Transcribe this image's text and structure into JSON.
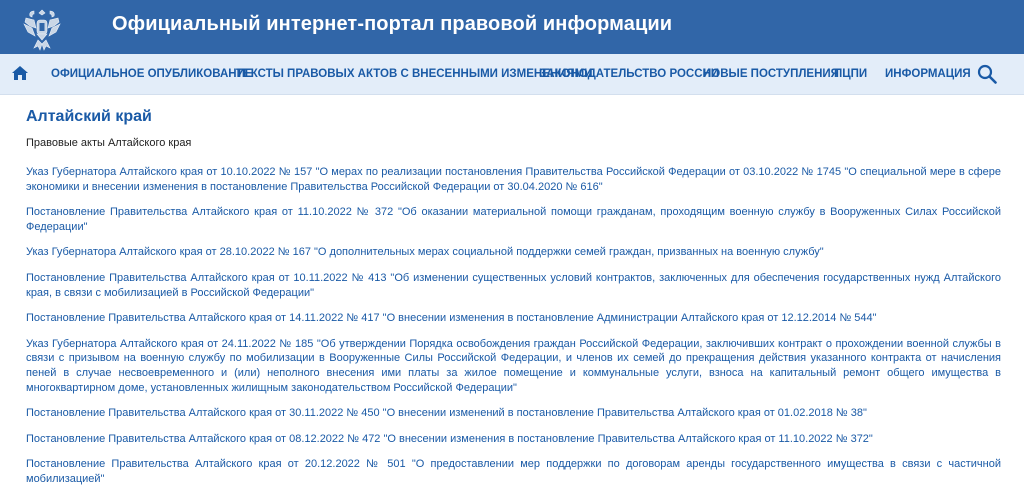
{
  "header": {
    "site_title": "Официальный интернет-портал правовой информации",
    "brand_color": "#3166a8"
  },
  "nav": {
    "home_icon": "home-icon",
    "search_icon": "search-icon",
    "items": [
      {
        "label": "ОФИЦИАЛЬНОЕ ОПУБЛИКОВАНИЕ"
      },
      {
        "label": "ТЕКСТЫ ПРАВОВЫХ АКТОВ С ВНЕСЕННЫМИ ИЗМЕНЕНИЯМИ"
      },
      {
        "label": "ЗАКОНОДАТЕЛЬСТВО РОССИИ"
      },
      {
        "label": "НОВЫЕ ПОСТУПЛЕНИЯ"
      },
      {
        "label": "ПЦПИ"
      },
      {
        "label": "ИНФОРМАЦИЯ"
      }
    ]
  },
  "main": {
    "region_title": "Алтайский край",
    "subtitle": "Правовые акты Алтайского края",
    "link_color": "#1a5aa6",
    "acts": [
      "Указ Губернатора Алтайского края от 10.10.2022 № 157 \"О мерах по реализации постановления Правительства Российской Федерации от 03.10.2022 № 1745 \"О специальной мере в сфере экономики и внесении изменения в постановление Правительства Российской Федерации от 30.04.2020 № 616\"",
      "Постановление Правительства Алтайского края от 11.10.2022 № 372 \"Об оказании материальной помощи гражданам, проходящим военную службу в Вооруженных Силах Российской Федерации\"",
      "Указ Губернатора Алтайского края от 28.10.2022 № 167 \"О дополнительных мерах социальной поддержки семей граждан, призванных на военную службу\"",
      "Постановление Правительства Алтайского края от 10.11.2022 № 413 \"Об изменении существенных условий контрактов, заключенных для обеспечения государственных нужд Алтайского края, в связи с мобилизацией в Российской Федерации\"",
      "Постановление Правительства Алтайского края от 14.11.2022 № 417 \"О внесении изменения в постановление Администрации Алтайского края от 12.12.2014 № 544\"",
      "Указ Губернатора Алтайского края от 24.11.2022 № 185 \"Об утверждении Порядка освобождения граждан Российской Федерации, заключивших контракт о прохождении военной службы в связи с призывом на военную службу по мобилизации в Вооруженные Силы Российской Федерации, и членов их семей до прекращения действия указанного контракта от начисления пеней в случае несвоевременного и (или) неполного внесения ими платы за жилое помещение и коммунальные услуги, взноса на капитальный ремонт общего имущества в многоквартирном доме, установленных жилищным законодательством Российской Федерации\"",
      "Постановление Правительства Алтайского края от 30.11.2022 № 450 \"О внесении изменений в постановление Правительства Алтайского края от 01.02.2018 № 38\"",
      "Постановление Правительства Алтайского края от 08.12.2022 № 472 \"О внесении изменения в постановление Правительства Алтайского края от 11.10.2022 № 372\"",
      "Постановление Правительства Алтайского края от 20.12.2022 № 501 \"О предоставлении мер поддержки по договорам аренды государственного имущества в связи с частичной мобилизацией\""
    ]
  }
}
